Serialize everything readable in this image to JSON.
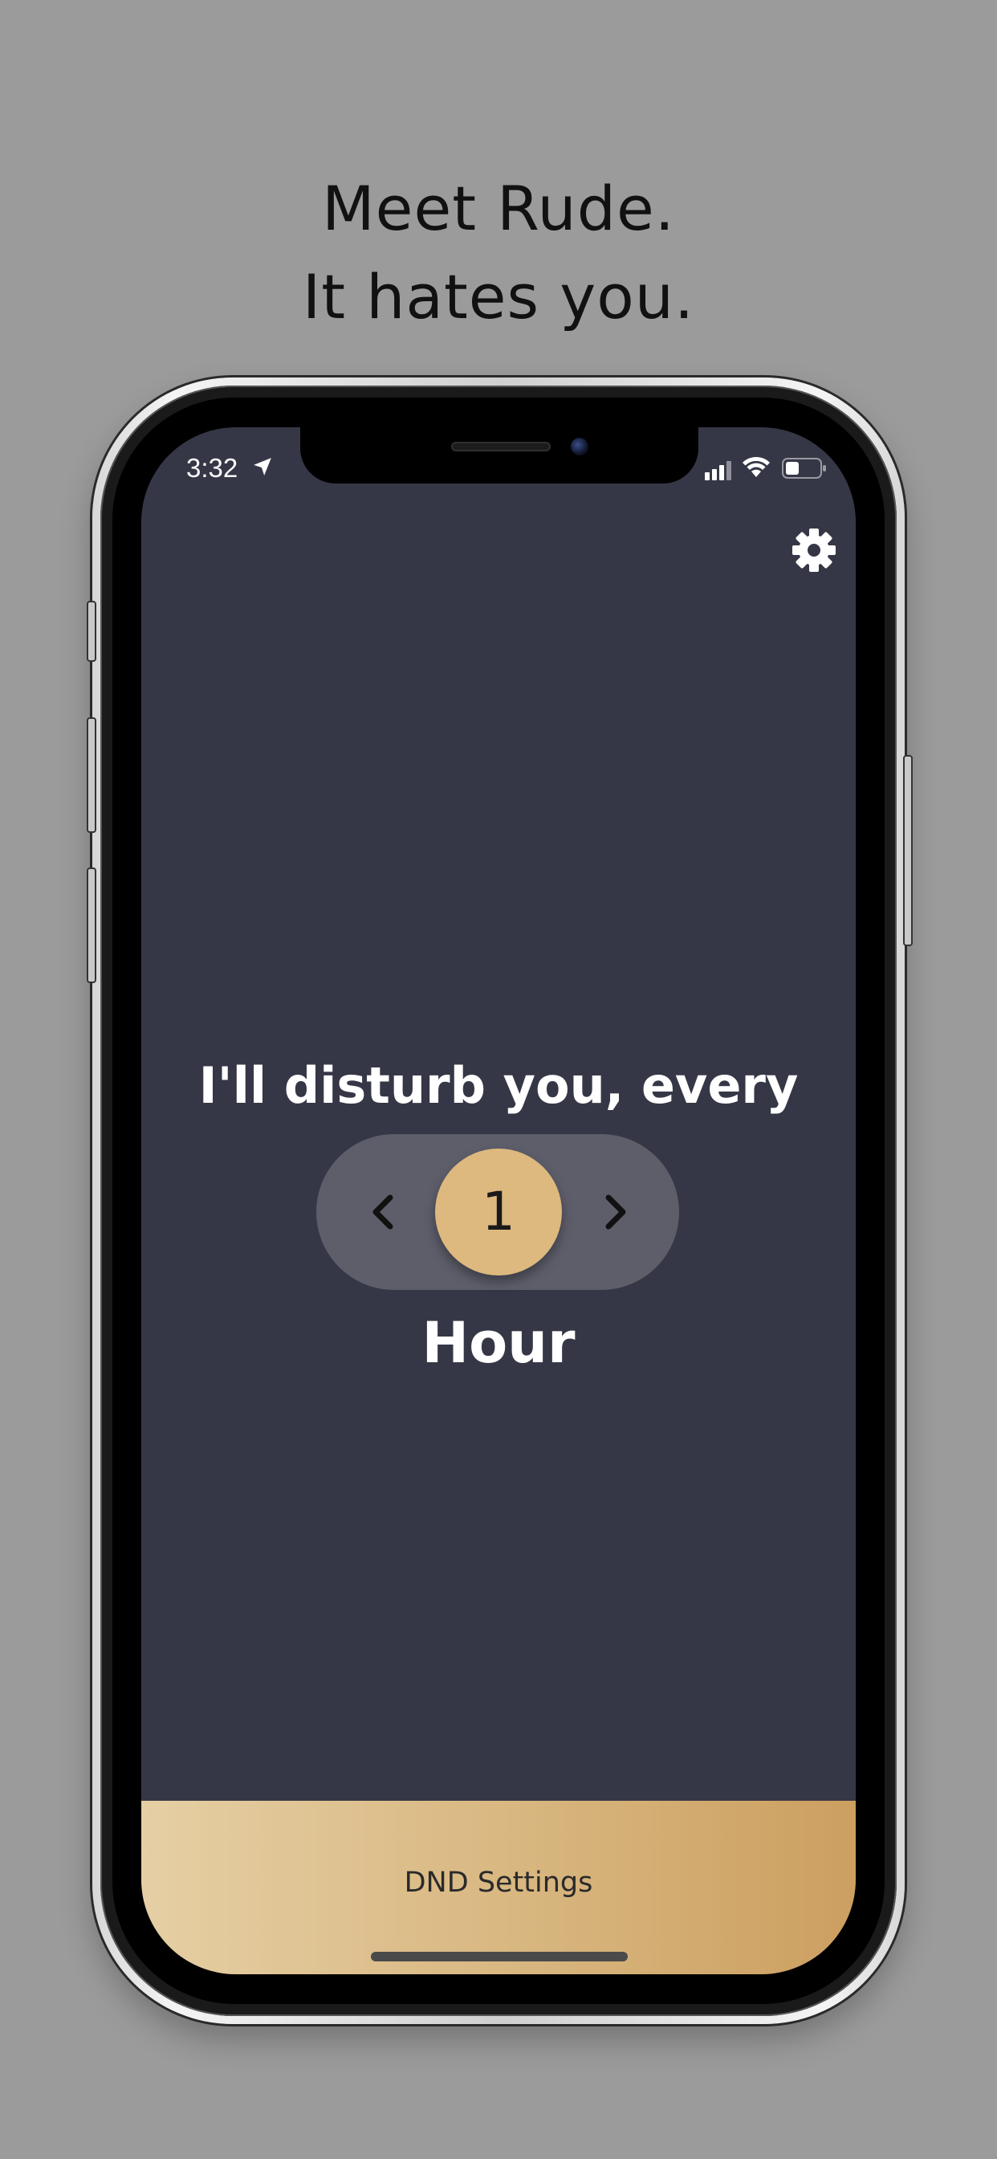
{
  "headline": {
    "line1": "Meet Rude.",
    "line2": "It hates you."
  },
  "status_bar": {
    "time": "3:32",
    "icons": [
      "location-arrow-icon",
      "cellular-signal-icon",
      "wifi-icon",
      "battery-icon"
    ]
  },
  "header": {
    "settings_icon": "gear-icon"
  },
  "main": {
    "prompt": "I'll disturb you, every",
    "stepper": {
      "value": "1",
      "prev_icon": "chevron-left-icon",
      "next_icon": "chevron-right-icon"
    },
    "unit": "Hour"
  },
  "bottom_bar": {
    "label": "DND Settings"
  },
  "colors": {
    "background": "#9b9b9b",
    "screen": "#363746",
    "stepper_track": "#5e5e6b",
    "accent_gold": "#ddb97f",
    "bar_gradient_start": "#e5cfa4",
    "bar_gradient_end": "#cc9f60"
  }
}
